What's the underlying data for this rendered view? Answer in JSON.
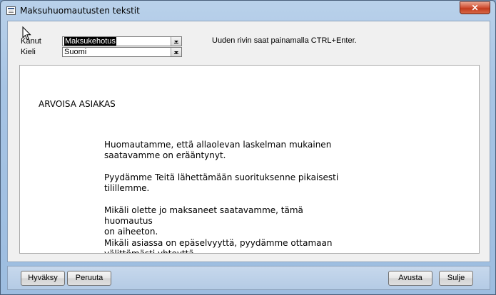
{
  "window": {
    "title": "Maksuhuomautusten tekstit",
    "close_label": "✕"
  },
  "form": {
    "kanut_label": "Kanut",
    "kanut_value": "Maksukehotus",
    "kieli_label": "Kieli",
    "kieli_value": "Suomi",
    "hint": "Uuden rivin saat painamalla CTRL+Enter."
  },
  "letter": {
    "greeting": "ARVOISA ASIAKAS",
    "paragraphs": [
      "Huomautamme, että allaolevan laskelman mukainen\nsaatavamme on erääntynyt.",
      "Pyydämme Teitä lähettämään suorituksenne pikaisesti\ntilillemme.",
      "Mikäli olette jo maksaneet saatavamme, tämä huomautus\non aiheeton.",
      "Mikäli asiassa on epäselvyyttä, pyydämme ottamaan\nvälittömästi yhteyttä."
    ]
  },
  "footer": {
    "accept": "Hyväksy",
    "cancel": "Peruuta",
    "help": "Avusta",
    "close": "Sulje"
  }
}
